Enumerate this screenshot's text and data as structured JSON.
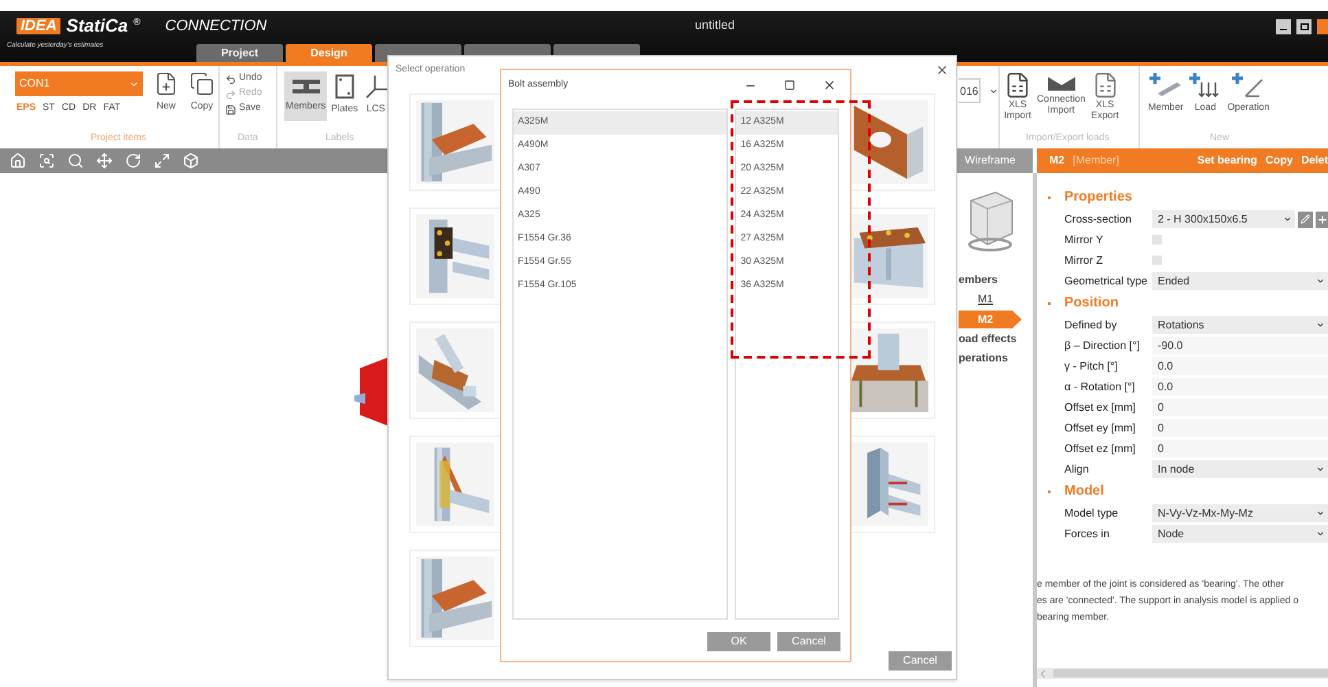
{
  "window": {
    "title": "untitled"
  },
  "brand": {
    "logo": "IDEA",
    "name": "StatiCa",
    "mark": "®",
    "product": "CONNECTION",
    "tagline": "Calculate yesterday's estimates"
  },
  "tabs": [
    {
      "label": "Project",
      "selected": false
    },
    {
      "label": "Design",
      "selected": true
    },
    {
      "selected": false
    },
    {
      "selected": false
    },
    {
      "selected": false
    }
  ],
  "ribbon": {
    "connection": "CON1",
    "project_types": [
      {
        "label": "EPS",
        "selected": true
      },
      {
        "label": "ST",
        "selected": false
      },
      {
        "label": "CD",
        "selected": false
      },
      {
        "label": "DR",
        "selected": false
      },
      {
        "label": "FAT",
        "selected": false
      }
    ],
    "project_buttons": [
      "New",
      "Copy"
    ],
    "project_group": "Project items",
    "data_buttons": [
      {
        "label": "Undo",
        "disabled": false
      },
      {
        "label": "Redo",
        "disabled": true
      },
      {
        "label": "Save",
        "disabled": false
      }
    ],
    "data_group": "Data",
    "label_buttons": [
      {
        "label": "Members",
        "selected": true
      },
      {
        "label": "Plates",
        "selected": false
      },
      {
        "label": "LCS",
        "selected": false
      }
    ],
    "labels_group": "Labels",
    "code_dropdown": "016",
    "import_buttons": [
      "XLS\nImport",
      "Connection\nImport",
      "XLS\nExport"
    ],
    "import_group": "Import/Export loads",
    "new_buttons": [
      "Member",
      "Load",
      "Operation"
    ],
    "new_group": "New"
  },
  "view_tab": "Wireframe",
  "navigator": {
    "items": [
      {
        "label": "embers",
        "kind": "group",
        "selected": false
      },
      {
        "label": "M1",
        "kind": "member",
        "selected": false
      },
      {
        "label": "M2",
        "kind": "member",
        "selected": true
      },
      {
        "label": "oad effects",
        "kind": "group",
        "selected": false
      },
      {
        "label": "perations",
        "kind": "group",
        "selected": false
      }
    ]
  },
  "panel": {
    "title": "M2",
    "subtitle": "[Member]",
    "actions": [
      "Set bearing",
      "Copy",
      "Delet"
    ],
    "sections": [
      {
        "title": "Properties",
        "rows": [
          {
            "label": "Cross-section",
            "kind": "section",
            "value": "2 - H 300x150x6.5"
          },
          {
            "label": "Mirror Y",
            "kind": "checkbox",
            "checked": false
          },
          {
            "label": "Mirror Z",
            "kind": "checkbox",
            "checked": false
          },
          {
            "label": "Geometrical type",
            "kind": "select",
            "value": "Ended"
          }
        ]
      },
      {
        "title": "Position",
        "rows": [
          {
            "label": "Defined by",
            "kind": "select",
            "value": "Rotations"
          },
          {
            "label": "β – Direction [°]",
            "kind": "text",
            "value": "-90.0"
          },
          {
            "label": "γ - Pitch [°]",
            "kind": "text",
            "value": "0.0"
          },
          {
            "label": "α - Rotation [°]",
            "kind": "text",
            "value": "0.0"
          },
          {
            "label": "Offset ex [mm]",
            "kind": "text",
            "value": "0"
          },
          {
            "label": "Offset ey [mm]",
            "kind": "text",
            "value": "0"
          },
          {
            "label": "Offset ez [mm]",
            "kind": "text",
            "value": "0"
          },
          {
            "label": "Align",
            "kind": "select",
            "value": "In node"
          }
        ]
      },
      {
        "title": "Model",
        "rows": [
          {
            "label": "Model type",
            "kind": "select",
            "value": "N-Vy-Vz-Mx-My-Mz"
          },
          {
            "label": "Forces in",
            "kind": "select",
            "value": "Node"
          }
        ]
      }
    ],
    "note": "e member of the joint is considered as 'bearing'. The other\nes are 'connected'. The support in analysis model is applied o\nbearing member."
  },
  "operation_dialog": {
    "title": "Select operation",
    "cancel": "Cancel"
  },
  "bolt_dialog": {
    "title": "Bolt assembly",
    "grades": [
      {
        "label": "A325M",
        "selected": true
      },
      {
        "label": "A490M",
        "selected": false
      },
      {
        "label": "A307",
        "selected": false
      },
      {
        "label": "A490",
        "selected": false
      },
      {
        "label": "A325",
        "selected": false
      },
      {
        "label": "F1554 Gr.36",
        "selected": false
      },
      {
        "label": "F1554 Gr.55",
        "selected": false
      },
      {
        "label": "F1554 Gr.105",
        "selected": false
      }
    ],
    "assemblies": [
      {
        "label": "12 A325M",
        "selected": true
      },
      {
        "label": "16 A325M",
        "selected": false
      },
      {
        "label": "20 A325M",
        "selected": false
      },
      {
        "label": "22 A325M",
        "selected": false
      },
      {
        "label": "24 A325M",
        "selected": false
      },
      {
        "label": "27 A325M",
        "selected": false
      },
      {
        "label": "30 A325M",
        "selected": false
      },
      {
        "label": "36 A325M",
        "selected": false
      }
    ],
    "ok": "OK",
    "cancel": "Cancel"
  }
}
